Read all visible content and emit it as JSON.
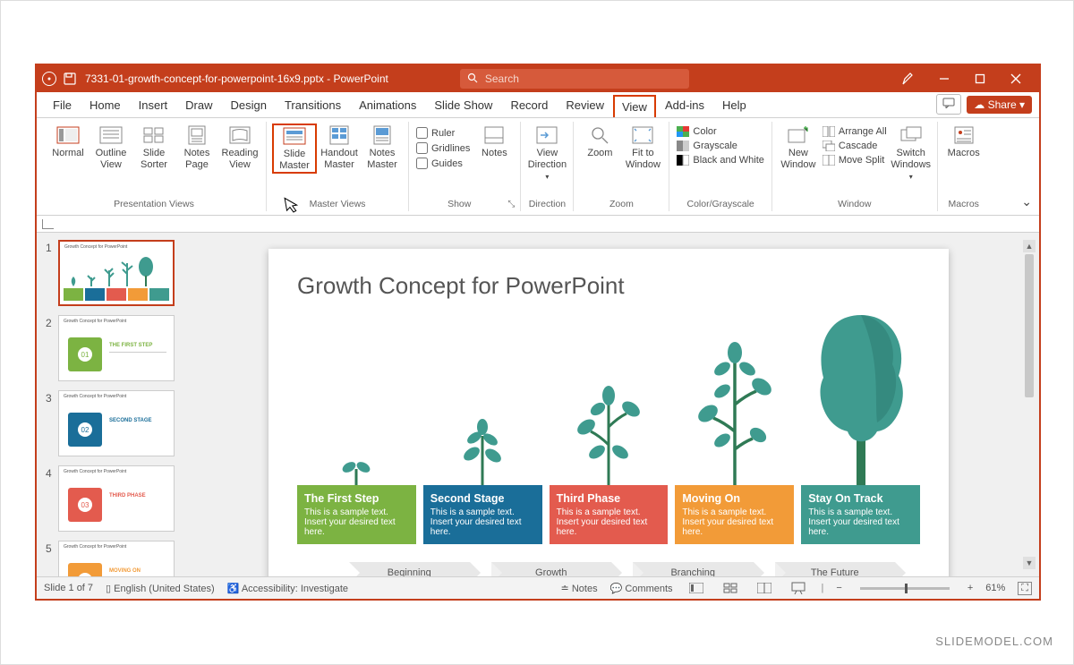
{
  "app": {
    "filename": "7331-01-growth-concept-for-powerpoint-16x9.pptx",
    "suffix": " - PowerPoint",
    "search_placeholder": "Search"
  },
  "window_controls": {
    "pen": "pen",
    "min": "minimize",
    "max": "restore",
    "close": "close"
  },
  "menu": {
    "items": [
      "File",
      "Home",
      "Insert",
      "Draw",
      "Design",
      "Transitions",
      "Animations",
      "Slide Show",
      "Record",
      "Review",
      "View",
      "Add-ins",
      "Help"
    ],
    "active": "View",
    "share": "Share"
  },
  "ribbon": {
    "presentation_views": {
      "label": "Presentation Views",
      "normal": "Normal",
      "outline": "Outline View",
      "sorter": "Slide Sorter",
      "notes_page": "Notes Page",
      "reading": "Reading View"
    },
    "master_views": {
      "label": "Master Views",
      "slide_master": "Slide Master",
      "handout": "Handout Master",
      "notes_master": "Notes Master"
    },
    "show": {
      "label": "Show",
      "ruler": "Ruler",
      "gridlines": "Gridlines",
      "guides": "Guides",
      "notes": "Notes"
    },
    "direction": {
      "label": "Direction",
      "btn": "View Direction"
    },
    "zoom": {
      "label": "Zoom",
      "zoom": "Zoom",
      "fit": "Fit to Window"
    },
    "color": {
      "label": "Color/Grayscale",
      "color": "Color",
      "grayscale": "Grayscale",
      "bw": "Black and White"
    },
    "window": {
      "label": "Window",
      "new": "New Window",
      "arrange": "Arrange All",
      "cascade": "Cascade",
      "split": "Move Split"
    },
    "switch": {
      "label": "",
      "btn": "Switch Windows"
    },
    "macros": {
      "label": "Macros",
      "btn": "Macros"
    }
  },
  "thumbnails": {
    "count": 5,
    "slide_of": "Slide 1 of 7"
  },
  "slide": {
    "title": "Growth Concept for PowerPoint",
    "stages": [
      {
        "title": "The First Step",
        "body": "This is a sample text. Insert your desired text here.",
        "color": "#7CB342"
      },
      {
        "title": "Second Stage",
        "body": "This is a sample text. Insert your desired text here.",
        "color": "#1A6E99"
      },
      {
        "title": "Third Phase",
        "body": "This is a sample text. Insert your desired text here.",
        "color": "#E35B4E"
      },
      {
        "title": "Moving On",
        "body": "This is a sample text. Insert your desired text here.",
        "color": "#F29B38"
      },
      {
        "title": "Stay On Track",
        "body": "This is a sample text. Insert your desired text here.",
        "color": "#3F9B8F"
      }
    ],
    "arrows": [
      "Beginning",
      "Growth",
      "Branching",
      "The Future"
    ]
  },
  "status": {
    "lang": "English (United States)",
    "access": "Accessibility: Investigate",
    "notes": "Notes",
    "comments": "Comments",
    "zoom": "61%"
  },
  "watermark": "SLIDEMODEL.COM"
}
